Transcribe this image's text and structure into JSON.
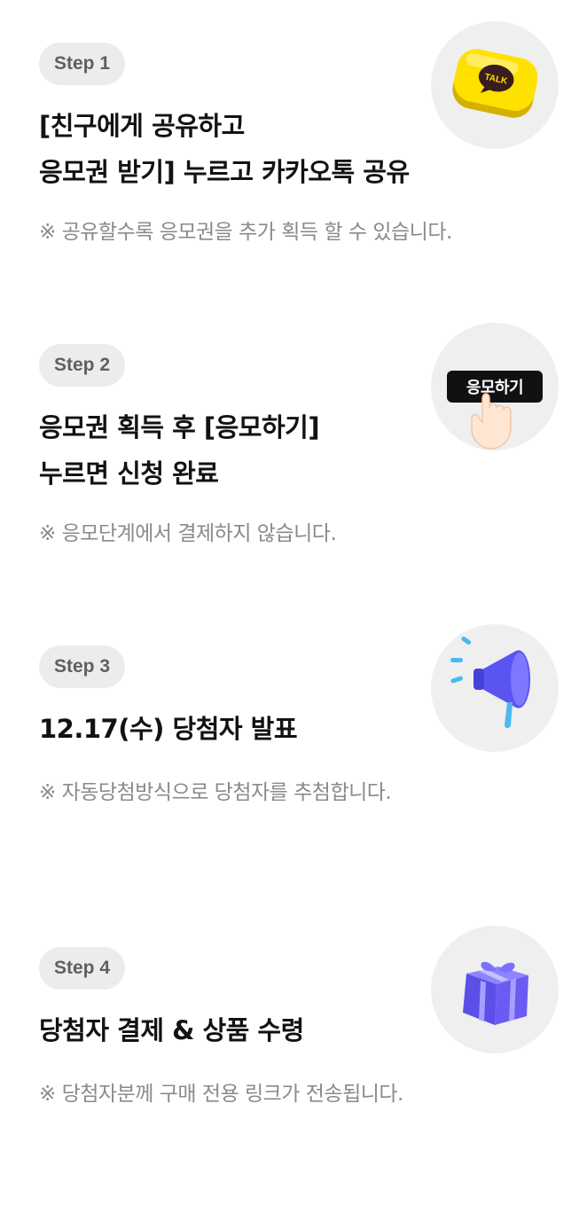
{
  "steps": [
    {
      "badge": "Step 1",
      "title_lines": [
        "[친구에게 공유하고",
        "응모권 받기] 누르고 카카오톡 공유"
      ],
      "note": "※ 공유할수록 응모권을 추가 획득 할 수 있습니다.",
      "icon": "kakaotalk-icon",
      "icon_text": "TALK"
    },
    {
      "badge": "Step 2",
      "title_lines": [
        "응모권 획득 후 [응모하기]",
        "누르면 신청 완료"
      ],
      "note": "※ 응모단계에서 결제하지 않습니다.",
      "icon": "pointing-hand-icon",
      "icon_text": "응모하기"
    },
    {
      "badge": "Step 3",
      "title_lines": [
        "12.17(수) 당첨자 발표"
      ],
      "note": "※ 자동당첨방식으로 당첨자를 추첨합니다.",
      "icon": "megaphone-icon"
    },
    {
      "badge": "Step 4",
      "title_lines": [
        "당첨자 결제 & 상품 수령"
      ],
      "note": "※ 당첨자분께 구매 전용 링크가 전송됩니다.",
      "icon": "gift-icon"
    }
  ],
  "colors": {
    "badge_bg": "#ececec",
    "badge_text": "#5f5f5f",
    "note_text": "#8a8a8a",
    "icon_circle": "#efefef",
    "kakao_yellow": "#ffe100",
    "megaphone_blue": "#5a55f0",
    "gift_purple": "#6a5cf2"
  }
}
